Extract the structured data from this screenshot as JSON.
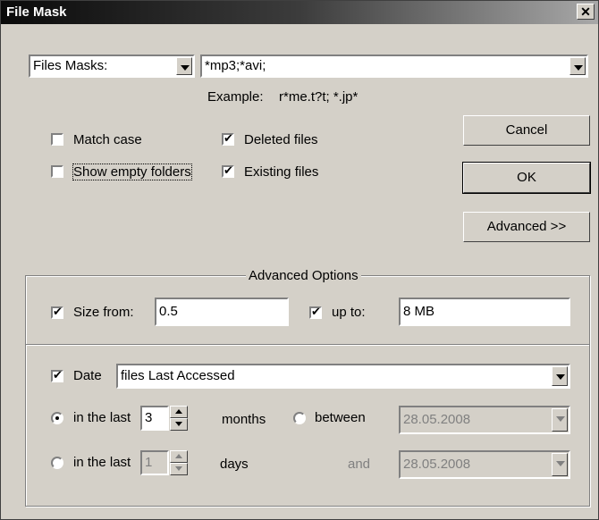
{
  "window": {
    "title": "File Mask",
    "close_glyph": "✕"
  },
  "filter": {
    "type_selected": "Files Masks:",
    "mask_value": "*mp3;*avi;",
    "example_label": "Example:",
    "example_value": "r*me.t?t; *.jp*"
  },
  "options": {
    "match_case": {
      "label": "Match case",
      "checked": false
    },
    "show_empty_folders": {
      "label": "Show empty folders",
      "checked": false
    },
    "deleted_files": {
      "label": "Deleted files",
      "checked": true
    },
    "existing_files": {
      "label": "Existing files",
      "checked": true
    }
  },
  "buttons": {
    "cancel": "Cancel",
    "ok": "OK",
    "advanced": "Advanced >>"
  },
  "advanced": {
    "group_title": "Advanced Options",
    "size_from_label": "Size from:",
    "size_from_checked": true,
    "size_from_value": "0.5",
    "up_to_label": "up to:",
    "up_to_checked": true,
    "up_to_value": "8 MB",
    "date_label": "Date",
    "date_checked": true,
    "date_type_selected": "files Last Accessed",
    "in_last_months_label": "in the last",
    "in_last_months_value": "3",
    "months_label": "months",
    "between_label": "between",
    "between_date": "28.05.2008",
    "in_last_days_label": "in the last",
    "in_last_days_value": "1",
    "days_label": "days",
    "and_label": "and",
    "and_date": "28.05.2008"
  }
}
